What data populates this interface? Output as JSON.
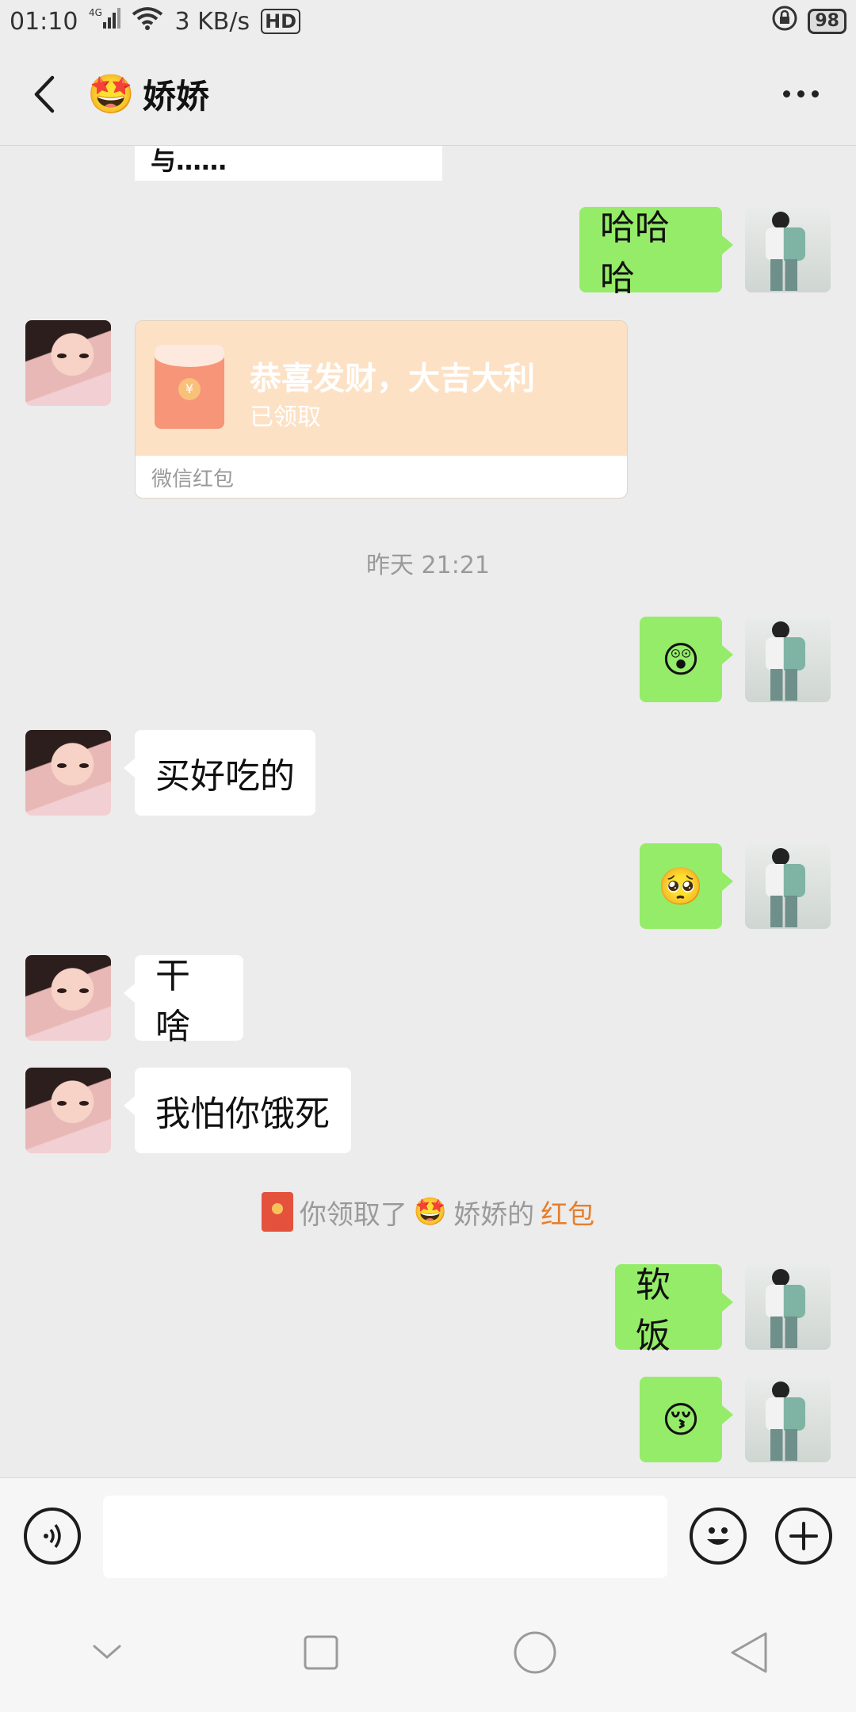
{
  "status_bar": {
    "time": "01:10",
    "network": "4G",
    "speed": "3 KB/s",
    "hd": "HD",
    "battery": "98"
  },
  "header": {
    "title_emoji": "🤩",
    "title": "娇娇"
  },
  "messages": {
    "truncated": "拟与拟与拟与拟与拟与……",
    "m1_out": "哈哈哈",
    "red_packet": {
      "title": "恭喜发财，大吉大利",
      "status": "已领取",
      "footer": "微信红包"
    },
    "timestamp": "昨天 21:21",
    "emoji_1": "😲",
    "m2_in": "买好吃的",
    "emoji_2": "🥺",
    "m3_in": "干啥",
    "m4_in": "我怕你饿死",
    "notice": {
      "prefix": "你领取了",
      "emoji": "🤩",
      "name": "娇娇的",
      "link": "红包"
    },
    "m5_out": "软饭",
    "emoji_3": "😚"
  },
  "input": {
    "value": "",
    "plus": "+"
  },
  "colors": {
    "bubble_out": "#95ec69",
    "bubble_in": "#ffffff",
    "red_packet": "#fde1c5",
    "link": "#e77e2c"
  }
}
